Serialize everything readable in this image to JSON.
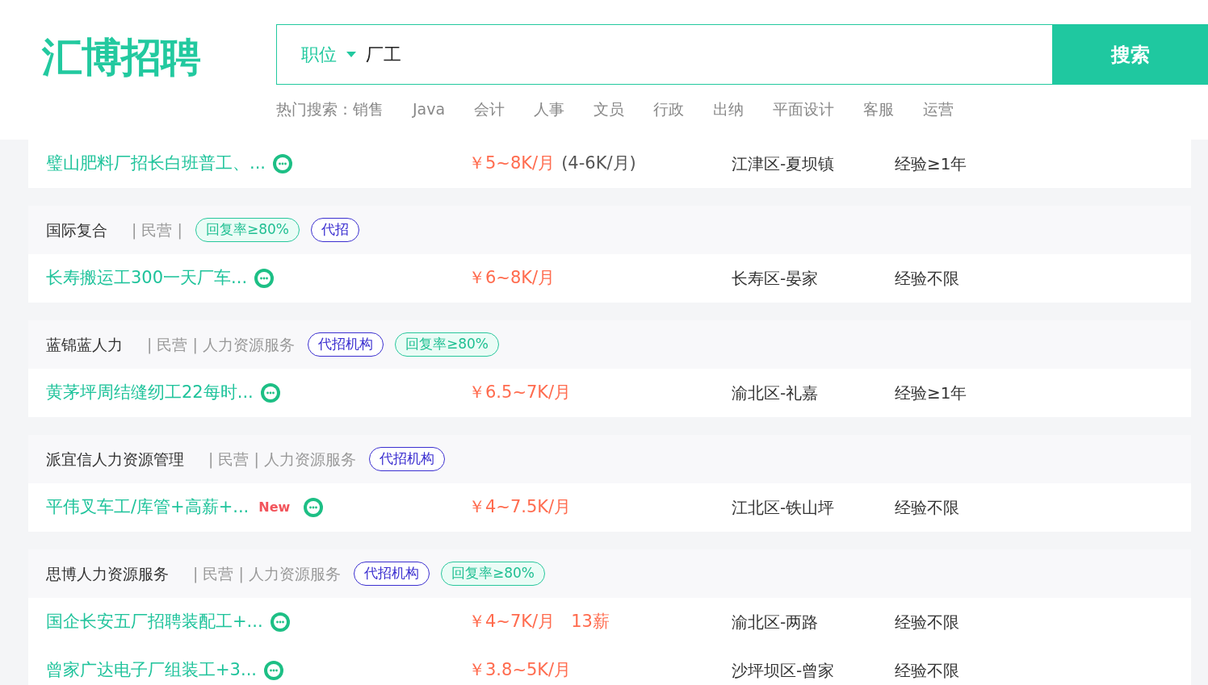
{
  "header": {
    "logo": "汇博招聘",
    "search": {
      "category": "职位",
      "value": "厂工",
      "button": "搜索"
    },
    "hot_label": "热门搜索：",
    "hot_items": [
      "销售",
      "Java",
      "会计",
      "人事",
      "文员",
      "行政",
      "出纳",
      "平面设计",
      "客服",
      "运营"
    ]
  },
  "cards": [
    {
      "jobs": [
        {
          "title": "璧山肥料厂招长白班普工、...",
          "salary": "￥5~8K/月",
          "salary_note": "(4-6K/月)",
          "location": "江津区-夏坝镇",
          "experience": "经验≥1年"
        }
      ]
    },
    {
      "company": {
        "name": "国际复合",
        "info": "| 民营 |",
        "tags": [
          {
            "kind": "reply",
            "label": "回复率≥80%"
          },
          {
            "kind": "agency",
            "label": "代招"
          }
        ]
      },
      "jobs": [
        {
          "title": "长寿搬运工300一天厂车...",
          "salary": "￥6~8K/月",
          "location": "长寿区-晏家",
          "experience": "经验不限"
        }
      ]
    },
    {
      "company": {
        "name": "蓝锦蓝人力",
        "info": "| 民营 | 人力资源服务",
        "tags": [
          {
            "kind": "agency",
            "label": "代招机构"
          },
          {
            "kind": "reply",
            "label": "回复率≥80%"
          }
        ]
      },
      "jobs": [
        {
          "title": "黄茅坪周结缝纫工22每时...",
          "salary": "￥6.5~7K/月",
          "location": "渝北区-礼嘉",
          "experience": "经验≥1年"
        }
      ]
    },
    {
      "company": {
        "name": "派宜信人力资源管理",
        "info": "| 民营 | 人力资源服务",
        "tags": [
          {
            "kind": "agency",
            "label": "代招机构"
          }
        ]
      },
      "jobs": [
        {
          "title": "平伟叉车工/库管+高薪+...",
          "new_label": "New",
          "salary": "￥4~7.5K/月",
          "location": "江北区-铁山坪",
          "experience": "经验不限"
        }
      ]
    },
    {
      "company": {
        "name": "思博人力资源服务",
        "info": "| 民营 | 人力资源服务",
        "tags": [
          {
            "kind": "agency",
            "label": "代招机构"
          },
          {
            "kind": "reply",
            "label": "回复率≥80%"
          }
        ]
      },
      "jobs": [
        {
          "title": "国企长安五厂招聘装配工+...",
          "salary": "￥4~7K/月",
          "extra": "13薪",
          "location": "渝北区-两路",
          "experience": "经验不限"
        },
        {
          "title": "曾家广达电子厂组装工+3...",
          "salary": "￥3.8~5K/月",
          "location": "沙坪坝区-曾家",
          "experience": "经验不限"
        }
      ]
    }
  ]
}
